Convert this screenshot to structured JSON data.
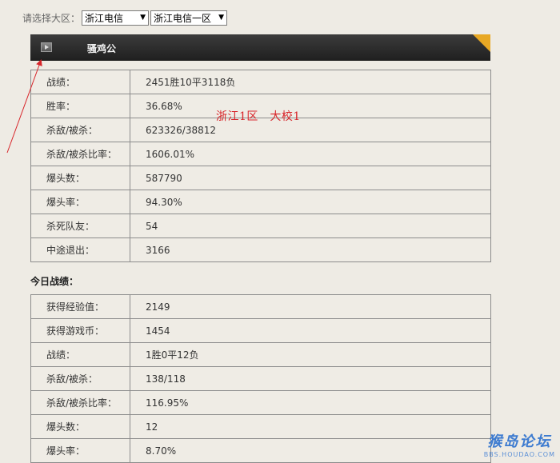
{
  "region": {
    "label": "请选择大区：",
    "select1": "浙江电信",
    "select2": "浙江电信一区"
  },
  "header": {
    "title": "骚鸡公"
  },
  "overlay_text": "浙江1区　大校1",
  "career": [
    {
      "key": "战绩：",
      "value": "2451胜10平3118负"
    },
    {
      "key": "胜率：",
      "value": "36.68%"
    },
    {
      "key": "杀敌/被杀：",
      "value": "623326/38812"
    },
    {
      "key": "杀敌/被杀比率：",
      "value": "1606.01%"
    },
    {
      "key": "爆头数：",
      "value": "587790"
    },
    {
      "key": "爆头率：",
      "value": "94.30%"
    },
    {
      "key": "杀死队友：",
      "value": "54"
    },
    {
      "key": "中途退出：",
      "value": "3166"
    }
  ],
  "today": {
    "heading": "今日战绩：",
    "rows": [
      {
        "key": "获得经验值：",
        "value": "2149"
      },
      {
        "key": "获得游戏币：",
        "value": "1454"
      },
      {
        "key": "战绩：",
        "value": "1胜0平12负"
      },
      {
        "key": "杀敌/被杀：",
        "value": "138/118"
      },
      {
        "key": "杀敌/被杀比率：",
        "value": "116.95%"
      },
      {
        "key": "爆头数：",
        "value": "12"
      },
      {
        "key": "爆头率：",
        "value": "8.70%"
      }
    ]
  },
  "watermark": {
    "main": "猴岛论坛",
    "sub": "BBS.HOUDAO.COM"
  },
  "colors": {
    "annotation": "#d8252a",
    "header_bg": "#2a2a2a",
    "corner": "#e8a824"
  }
}
